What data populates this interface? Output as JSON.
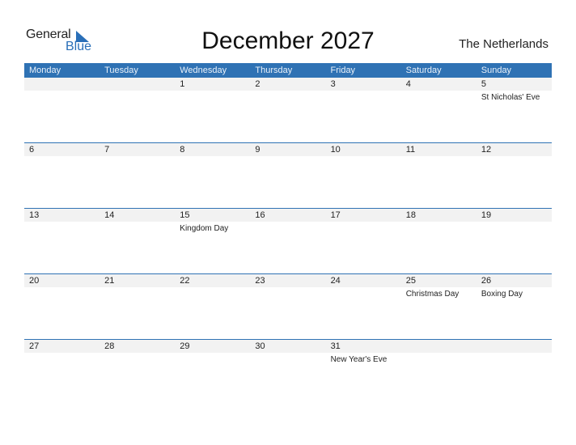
{
  "brand": {
    "line1": "General",
    "line2": "Blue",
    "color": "#2a6fb8"
  },
  "title": "December 2027",
  "country": "The Netherlands",
  "weekdays": [
    "Monday",
    "Tuesday",
    "Wednesday",
    "Thursday",
    "Friday",
    "Saturday",
    "Sunday"
  ],
  "weeks": [
    [
      {
        "day": ""
      },
      {
        "day": ""
      },
      {
        "day": "1"
      },
      {
        "day": "2"
      },
      {
        "day": "3"
      },
      {
        "day": "4"
      },
      {
        "day": "5",
        "holiday": "St Nicholas' Eve"
      }
    ],
    [
      {
        "day": "6"
      },
      {
        "day": "7"
      },
      {
        "day": "8"
      },
      {
        "day": "9"
      },
      {
        "day": "10"
      },
      {
        "day": "11"
      },
      {
        "day": "12"
      }
    ],
    [
      {
        "day": "13"
      },
      {
        "day": "14"
      },
      {
        "day": "15",
        "holiday": "Kingdom Day"
      },
      {
        "day": "16"
      },
      {
        "day": "17"
      },
      {
        "day": "18"
      },
      {
        "day": "19"
      }
    ],
    [
      {
        "day": "20"
      },
      {
        "day": "21"
      },
      {
        "day": "22"
      },
      {
        "day": "23"
      },
      {
        "day": "24"
      },
      {
        "day": "25",
        "holiday": "Christmas Day"
      },
      {
        "day": "26",
        "holiday": "Boxing Day"
      }
    ],
    [
      {
        "day": "27"
      },
      {
        "day": "28"
      },
      {
        "day": "29"
      },
      {
        "day": "30"
      },
      {
        "day": "31",
        "holiday": "New Year's Eve"
      },
      {
        "day": ""
      },
      {
        "day": ""
      }
    ]
  ],
  "colors": {
    "header_bg": "#2f72b4",
    "strip_bg": "#f2f2f2"
  }
}
